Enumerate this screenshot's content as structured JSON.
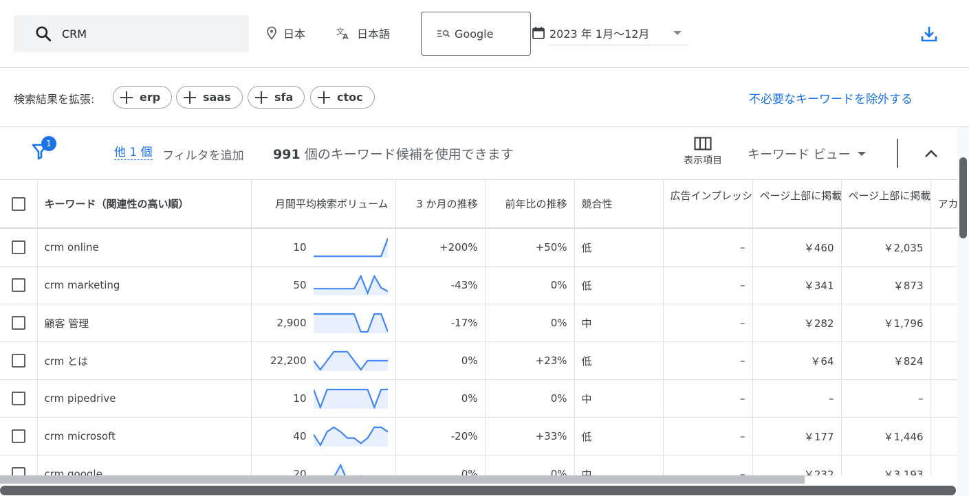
{
  "header": {
    "search_value": "CRM",
    "location": "日本",
    "language": "日本語",
    "engine": "Google",
    "date_range": "2023 年 1月～12月"
  },
  "refine": {
    "label": "検索結果を拡張:",
    "chips": [
      "erp",
      "saas",
      "sfa",
      "ctoc"
    ],
    "exclude_link": "不必要なキーワードを除外する"
  },
  "filterbar": {
    "badge_count": "1",
    "other_link": "他 1 個",
    "add_filter": "フィルタを追加",
    "count_number": "991",
    "count_text": " 個のキーワード候補を使用できます",
    "columns_label": "表示項目",
    "view_label": "キーワード ビュー"
  },
  "table": {
    "headers": {
      "keyword": "キーワード（関連性の高い順）",
      "volume": "月間平均検索ボリューム",
      "three_month": "3 か月の推移",
      "yoy": "前年比の推移",
      "competition": "競合性",
      "impression": "広告インプレッション",
      "top_low": "ページ上部に掲載された広告の入札単価（低額帯）",
      "top_high": "ページ上部に掲載された広告の入札単価（高額帯）",
      "account": "アカウントのステータス"
    },
    "rows": [
      {
        "keyword": "crm online",
        "volume": "10",
        "three_month": "+200%",
        "yoy": "+50%",
        "competition": "低",
        "impression": "–",
        "top_low": "￥460",
        "top_high": "￥2,035",
        "trend": [
          0,
          0,
          0,
          0,
          0,
          0,
          0,
          0,
          0,
          0,
          0,
          1
        ]
      },
      {
        "keyword": "crm marketing",
        "volume": "50",
        "three_month": "-43%",
        "yoy": "0%",
        "competition": "低",
        "impression": "–",
        "top_low": "￥341",
        "top_high": "￥873",
        "trend": [
          0.3,
          0.3,
          0.3,
          0.3,
          0.3,
          0.3,
          0.3,
          1,
          0.05,
          1,
          0.35,
          0.15
        ]
      },
      {
        "keyword": "顧客 管理",
        "volume": "2,900",
        "three_month": "-17%",
        "yoy": "0%",
        "competition": "中",
        "impression": "–",
        "top_low": "￥282",
        "top_high": "￥1,796",
        "trend": [
          1,
          1,
          1,
          1,
          1,
          1,
          1,
          0,
          0,
          1,
          1,
          0
        ]
      },
      {
        "keyword": "crm とは",
        "volume": "22,200",
        "three_month": "0%",
        "yoy": "+23%",
        "competition": "低",
        "impression": "–",
        "top_low": "￥64",
        "top_high": "￥824",
        "trend": [
          0.5,
          0,
          0.5,
          1,
          1,
          1,
          0.5,
          0,
          0.5,
          0.5,
          0.5,
          0.5
        ]
      },
      {
        "keyword": "crm pipedrive",
        "volume": "10",
        "three_month": "0%",
        "yoy": "0%",
        "competition": "中",
        "impression": "–",
        "top_low": "–",
        "top_high": "–",
        "trend": [
          1,
          0,
          1,
          1,
          1,
          1,
          1,
          1,
          1,
          0,
          1,
          1
        ]
      },
      {
        "keyword": "crm microsoft",
        "volume": "40",
        "three_month": "-20%",
        "yoy": "+33%",
        "competition": "低",
        "impression": "–",
        "top_low": "￥177",
        "top_high": "￥1,446",
        "trend": [
          0.6,
          0,
          0.75,
          1,
          0.75,
          0.4,
          0.4,
          0.1,
          0.4,
          1,
          1,
          0.75
        ]
      },
      {
        "keyword": "crm google",
        "volume": "20",
        "three_month": "0%",
        "yoy": "0%",
        "competition": "中",
        "impression": "–",
        "top_low": "￥232",
        "top_high": "￥3,193",
        "trend": [
          0.1,
          0.1,
          0.1,
          0.3,
          1,
          0.1,
          0.1,
          0.4,
          0.1,
          0.1,
          0.1,
          0.1
        ]
      }
    ]
  },
  "colors": {
    "accent": "#1a73e8",
    "sparkline": "#4285f4",
    "sparkline_fill": "#e8f0fe"
  }
}
